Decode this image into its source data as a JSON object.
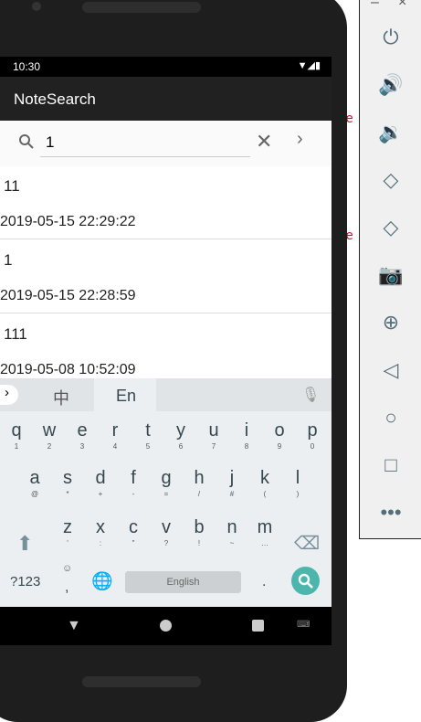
{
  "status_bar": {
    "time": "10:30"
  },
  "app_bar": {
    "title": "NoteSearch"
  },
  "search": {
    "value": "1"
  },
  "notes": [
    {
      "title": "11",
      "date": "2019-05-15 22:29:22"
    },
    {
      "title": "1",
      "date": "2019-05-15 22:28:59"
    },
    {
      "title": "111",
      "date": "2019-05-08 10:52:09"
    }
  ],
  "keyboard": {
    "lang_chinese": "中",
    "lang_english": "En",
    "row1": [
      [
        "q",
        "1"
      ],
      [
        "w",
        "2"
      ],
      [
        "e",
        "3"
      ],
      [
        "r",
        "4"
      ],
      [
        "t",
        "5"
      ],
      [
        "y",
        "6"
      ],
      [
        "u",
        "7"
      ],
      [
        "i",
        "8"
      ],
      [
        "o",
        "9"
      ],
      [
        "p",
        "0"
      ]
    ],
    "row2": [
      [
        "a",
        "@"
      ],
      [
        "s",
        "*"
      ],
      [
        "d",
        "+"
      ],
      [
        "f",
        "-"
      ],
      [
        "g",
        "="
      ],
      [
        "h",
        "/"
      ],
      [
        "j",
        "#"
      ],
      [
        "k",
        "("
      ],
      [
        "l",
        ")"
      ]
    ],
    "row3": [
      [
        "z",
        "'"
      ],
      [
        "x",
        ":"
      ],
      [
        "c",
        "\""
      ],
      [
        "v",
        "?"
      ],
      [
        "b",
        "!"
      ],
      [
        "n",
        "~"
      ],
      [
        "m",
        "…"
      ]
    ],
    "symbols_label": "?123",
    "comma": ",",
    "space_label": "English",
    "period": ".",
    "accent_color": "#4db6ac"
  },
  "emulator_panel": {
    "icons": [
      "power-icon",
      "volume-up-icon",
      "volume-down-icon",
      "rotate-left-icon",
      "rotate-right-icon",
      "camera-icon",
      "zoom-icon",
      "back-icon",
      "home-icon",
      "overview-icon",
      "more-icon"
    ],
    "minimize": "–",
    "close": "×"
  }
}
